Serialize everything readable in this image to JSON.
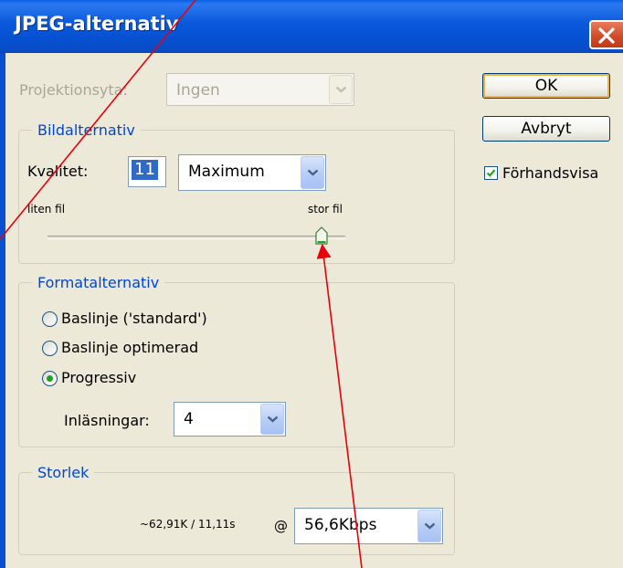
{
  "window": {
    "title": "JPEG-alternativ"
  },
  "projection": {
    "label": "Projektionsyta:",
    "value": "Ingen"
  },
  "image_options": {
    "legend": "Bildalternativ",
    "quality_label": "Kvalitet:",
    "quality_value": "11",
    "quality_preset": "Maximum",
    "slider_min_label": "liten fil",
    "slider_max_label": "stor fil",
    "slider_level": 0.92
  },
  "format_options": {
    "legend": "Formatalternativ",
    "choices": [
      {
        "label": "Baslinje ('standard')",
        "selected": false
      },
      {
        "label": "Baslinje optimerad",
        "selected": false
      },
      {
        "label": "Progressiv",
        "selected": true
      }
    ],
    "scans_label": "Inläsningar:",
    "scans_value": "4"
  },
  "size": {
    "legend": "Storlek",
    "estimate": "~62,91K / 11,11s",
    "at": "@",
    "speed": "56,6Kbps"
  },
  "buttons": {
    "ok": "OK",
    "cancel": "Avbryt"
  },
  "preview": {
    "label": "Förhandsvisa",
    "checked": true
  },
  "icons": [
    "close-icon",
    "chevron-down-icon",
    "slider-thumb-icon",
    "checkmark-icon"
  ],
  "annotation_color": "#e8000b"
}
